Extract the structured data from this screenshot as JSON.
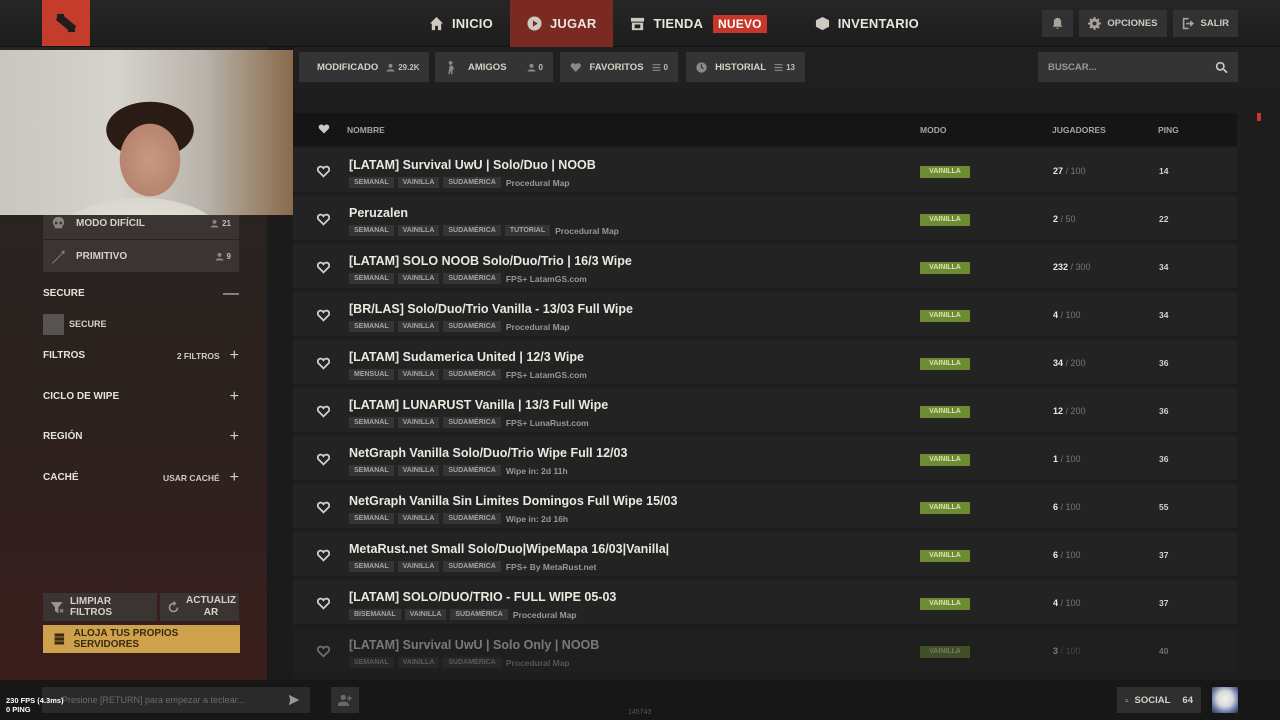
{
  "nav": {
    "items": [
      {
        "label": "INICIO",
        "icon": "home-icon"
      },
      {
        "label": "JUGAR",
        "icon": "play-icon",
        "active": true
      },
      {
        "label": "TIENDA",
        "icon": "store-icon",
        "badge": "NUEVO"
      },
      {
        "label": "INVENTARIO",
        "icon": "box-icon"
      }
    ],
    "opciones": "OPCIONES",
    "salir": "SALIR"
  },
  "tabs": {
    "modificado": {
      "label": "MODIFICADO",
      "count": "29.2K"
    },
    "amigos": {
      "label": "AMIGOS",
      "count": "0"
    },
    "favoritos": {
      "label": "FAVORITOS",
      "count": "0"
    },
    "historial": {
      "label": "HISTORIAL",
      "count": "13"
    },
    "search_placeholder": "BUSCAR..."
  },
  "sidebar": {
    "modes": [
      {
        "label": "MODO DIFÍCIL",
        "count": "21",
        "icon": "skull-icon"
      },
      {
        "label": "PRIMITIVO",
        "count": "9",
        "icon": "spear-icon"
      }
    ],
    "secure_title": "SECURE",
    "secure_option": "SECURE",
    "filtros_label": "FILTROS",
    "filtros_count": "2 FILTROS",
    "ciclo_label": "CICLO DE WIPE",
    "region_label": "REGIÓN",
    "cache_label": "CACHÉ",
    "cache_value": "USAR CACHÉ",
    "clear_button": "LIMPIAR FILTROS",
    "refresh_button_1": "ACTUALIZ",
    "refresh_button_2": "AR",
    "host_button": "ALOJA TUS PROPIOS SERVIDORES"
  },
  "table": {
    "headers": {
      "name": "NOMBRE",
      "mode": "MODO",
      "players": "JUGADORES",
      "ping": "PING"
    },
    "rows": [
      {
        "name": "[LATAM] Survival UwU | Solo/Duo | NOOB",
        "tags": [
          "SEMANAL",
          "VAINILLA",
          "SUDAMÉRICA"
        ],
        "desc": "Procedural Map",
        "mode": "VAINILLA",
        "players": "27",
        "max": "100",
        "ping": "14"
      },
      {
        "name": "Peruzalen",
        "tags": [
          "SEMANAL",
          "VAINILLA",
          "SUDAMÉRICA",
          "TUTORIAL"
        ],
        "desc": "Procedural Map",
        "mode": "VAINILLA",
        "players": "2",
        "max": "50",
        "ping": "22"
      },
      {
        "name": "[LATAM] SOLO NOOB Solo/Duo/Trio | 16/3 Wipe",
        "tags": [
          "SEMANAL",
          "VAINILLA",
          "SUDAMÉRICA"
        ],
        "desc": "FPS+ LatamGS.com",
        "mode": "VAINILLA",
        "players": "232",
        "max": "300",
        "ping": "34"
      },
      {
        "name": "[BR/LAS] Solo/Duo/Trio Vanilla - 13/03 Full Wipe",
        "tags": [
          "SEMANAL",
          "VAINILLA",
          "SUDAMÉRICA"
        ],
        "desc": "Procedural Map",
        "mode": "VAINILLA",
        "players": "4",
        "max": "100",
        "ping": "34"
      },
      {
        "name": "[LATAM] Sudamerica United | 12/3 Wipe",
        "tags": [
          "MENSUAL",
          "VAINILLA",
          "SUDAMÉRICA"
        ],
        "desc": "FPS+ LatamGS.com",
        "mode": "VAINILLA",
        "players": "34",
        "max": "200",
        "ping": "36"
      },
      {
        "name": "[LATAM] LUNARUST Vanilla | 13/3 Full Wipe",
        "tags": [
          "SEMANAL",
          "VAINILLA",
          "SUDAMÉRICA"
        ],
        "desc": "FPS+ LunaRust.com",
        "mode": "VAINILLA",
        "players": "12",
        "max": "200",
        "ping": "36"
      },
      {
        "name": "NetGraph Vanilla Solo/Duo/Trio Wipe Full 12/03",
        "tags": [
          "SEMANAL",
          "VAINILLA",
          "SUDAMÉRICA"
        ],
        "desc": "Wipe in: 2d 11h",
        "mode": "VAINILLA",
        "players": "1",
        "max": "100",
        "ping": "36"
      },
      {
        "name": "NetGraph Vanilla Sin Limites Domingos Full Wipe 15/03",
        "tags": [
          "SEMANAL",
          "VAINILLA",
          "SUDAMÉRICA"
        ],
        "desc": "Wipe in: 2d 16h",
        "mode": "VAINILLA",
        "players": "6",
        "max": "100",
        "ping": "55"
      },
      {
        "name": "MetaRust.net Small Solo/Duo|WipeMapa 16/03|Vanilla|",
        "tags": [
          "SEMANAL",
          "VAINILLA",
          "SUDAMÉRICA"
        ],
        "desc": "FPS+ By MetaRust.net",
        "mode": "VAINILLA",
        "players": "6",
        "max": "100",
        "ping": "37"
      },
      {
        "name": "[LATAM] SOLO/DUO/TRIO - FULL WIPE 05-03",
        "tags": [
          "BISEMANAL",
          "VAINILLA",
          "SUDAMÉRICA"
        ],
        "desc": "Procedural Map",
        "mode": "VAINILLA",
        "players": "4",
        "max": "100",
        "ping": "37"
      },
      {
        "name": "[LATAM] Survival UwU | Solo Only | NOOB",
        "tags": [
          "SEMANAL",
          "VAINILLA",
          "SUDAMÉRICA"
        ],
        "desc": "Procedural Map",
        "mode": "VAINILLA",
        "players": "3",
        "max": "100",
        "ping": "40"
      }
    ]
  },
  "bottom": {
    "fps": "230 FPS (4.3ms)",
    "ping": "0 PING",
    "chat_placeholder": "Presione [RETURN] para empezar a teclear...",
    "center_number": "145743",
    "social_label": "SOCIAL",
    "social_count": "64"
  },
  "colors": {
    "accent": "#c8362a",
    "active_tab": "#7a2a20",
    "host_button": "#cea24d",
    "vanilla_badge": "#6d8c32"
  }
}
